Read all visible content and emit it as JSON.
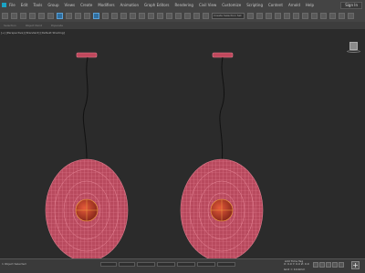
{
  "menubar": {
    "items": [
      "File",
      "Edit",
      "Tools",
      "Group",
      "Views",
      "Create",
      "Modifiers",
      "Animation",
      "Graph Editors",
      "Rendering",
      "Civil View",
      "Customize",
      "Scripting",
      "Content",
      "Arnold",
      "Help"
    ],
    "sign_in_label": "Sign In"
  },
  "toolbar": {
    "selection_set_placeholder": "Create Selection Set"
  },
  "ribbon": {
    "items": [
      "Selection",
      "Object Paint",
      "Populate"
    ]
  },
  "viewport": {
    "label": "[+] [Perspective] [Standard] [Default Shading]",
    "mesh_color": "#d8667a",
    "node_color": "#c9442f",
    "background": "#2b2b2b"
  },
  "statusbar": {
    "status_text": "1 Object Selected",
    "coordinates": "X: 0.0  Y: 0.0  Z: 0.0",
    "grid": "Grid = 10.0mm",
    "time_tag": "Add Time Tag",
    "add_button": "+"
  }
}
